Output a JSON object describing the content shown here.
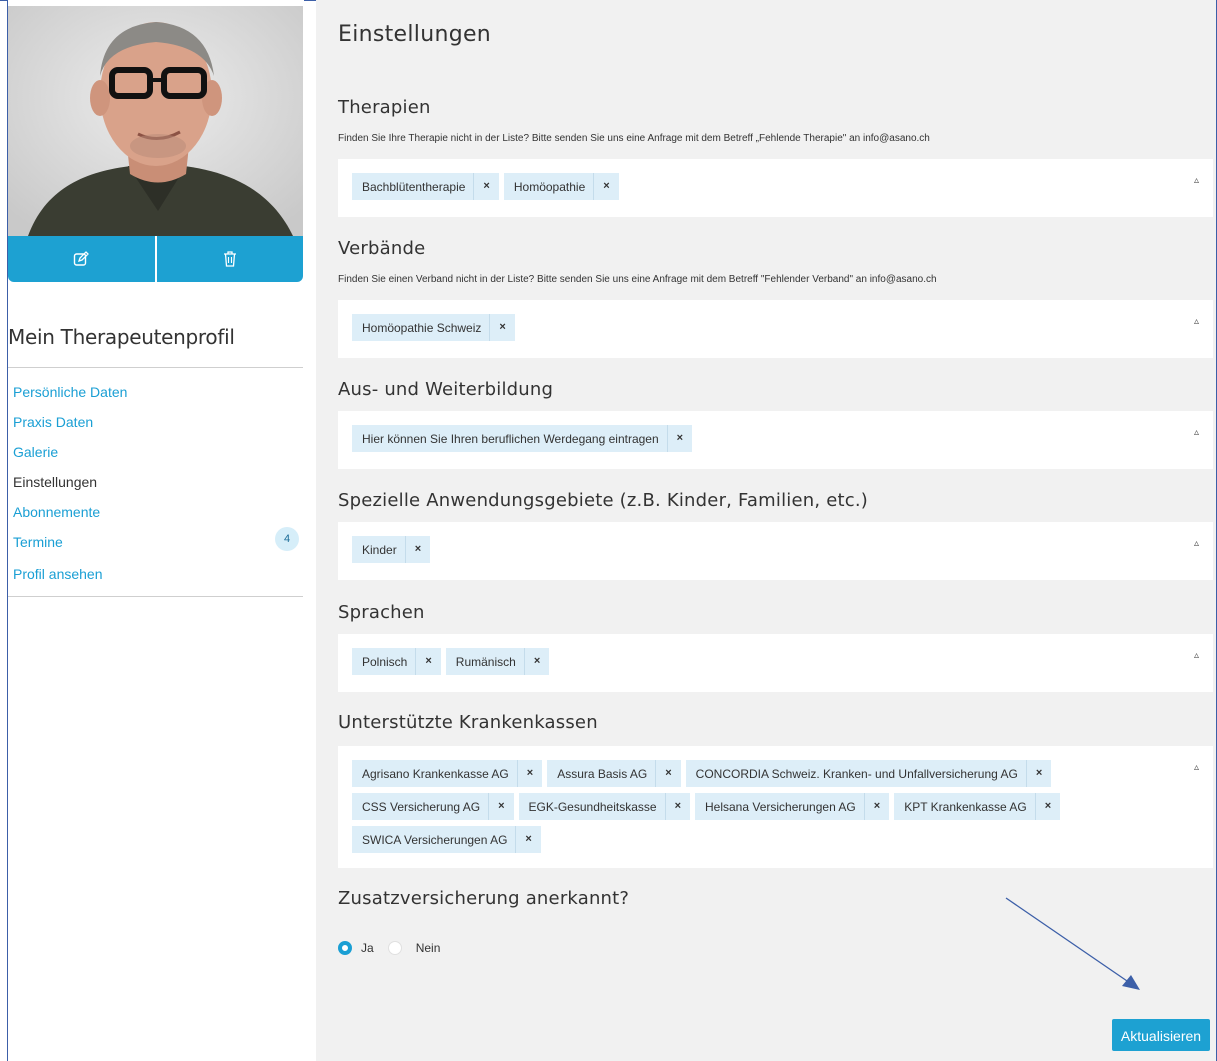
{
  "sidebar": {
    "profile_title": "Mein Therapeutenprofil",
    "nav": [
      {
        "label": "Persönliche Daten",
        "active": false
      },
      {
        "label": "Praxis Daten",
        "active": false
      },
      {
        "label": "Galerie",
        "active": false
      },
      {
        "label": "Einstellungen",
        "active": true
      },
      {
        "label": "Abonnemente",
        "active": false
      },
      {
        "label": "Termine",
        "active": false,
        "badge": "4"
      },
      {
        "label": "Profil ansehen",
        "active": false
      }
    ],
    "photo_actions": {
      "edit_icon": "edit-icon",
      "delete_icon": "trash-icon"
    }
  },
  "main": {
    "title": "Einstellungen",
    "sections": {
      "therapien": {
        "heading": "Therapien",
        "hint": "Finden Sie Ihre Therapie nicht in der Liste? Bitte senden Sie uns eine Anfrage mit dem Betreff „Fehlende Therapie\" an info@asano.ch",
        "tags": [
          "Bachblütentherapie",
          "Homöopathie"
        ]
      },
      "verbaende": {
        "heading": "Verbände",
        "hint": "Finden Sie einen Verband nicht in der Liste? Bitte senden Sie uns eine Anfrage mit dem Betreff \"Fehlender Verband\" an info@asano.ch",
        "tags": [
          "Homöopathie Schweiz"
        ]
      },
      "ausbildung": {
        "heading": "Aus- und Weiterbildung",
        "tags": [
          "Hier können Sie Ihren beruflichen Werdegang eintragen"
        ]
      },
      "anwendungsgebiete": {
        "heading": "Spezielle Anwendungsgebiete (z.B. Kinder, Familien, etc.)",
        "tags": [
          "Kinder"
        ]
      },
      "sprachen": {
        "heading": "Sprachen",
        "tags": [
          "Polnisch",
          "Rumänisch"
        ]
      },
      "krankenkassen": {
        "heading": "Unterstützte Krankenkassen",
        "tags": [
          "Agrisano Krankenkasse AG",
          "Assura Basis AG",
          "CONCORDIA Schweiz. Kranken- und Unfallversicherung AG",
          "CSS Versicherung AG",
          "EGK-Gesundheitskasse",
          "Helsana Versicherungen AG",
          "KPT Krankenkasse AG",
          "SWICA Versicherungen AG"
        ]
      }
    },
    "tag_remove_glyph": "×",
    "dropdown_glyph": "▵",
    "zusatz": {
      "heading": "Zusatzversicherung anerkannt?",
      "options": [
        {
          "label": "Ja",
          "selected": true
        },
        {
          "label": "Nein",
          "selected": false
        }
      ]
    },
    "submit_label": "Aktualisieren"
  },
  "colors": {
    "accent": "#1da1d2",
    "link": "#1a9fd4",
    "tag_bg": "#ddeef8",
    "panel_bg": "#f1f1f1",
    "annotation": "#3c5fa8"
  }
}
